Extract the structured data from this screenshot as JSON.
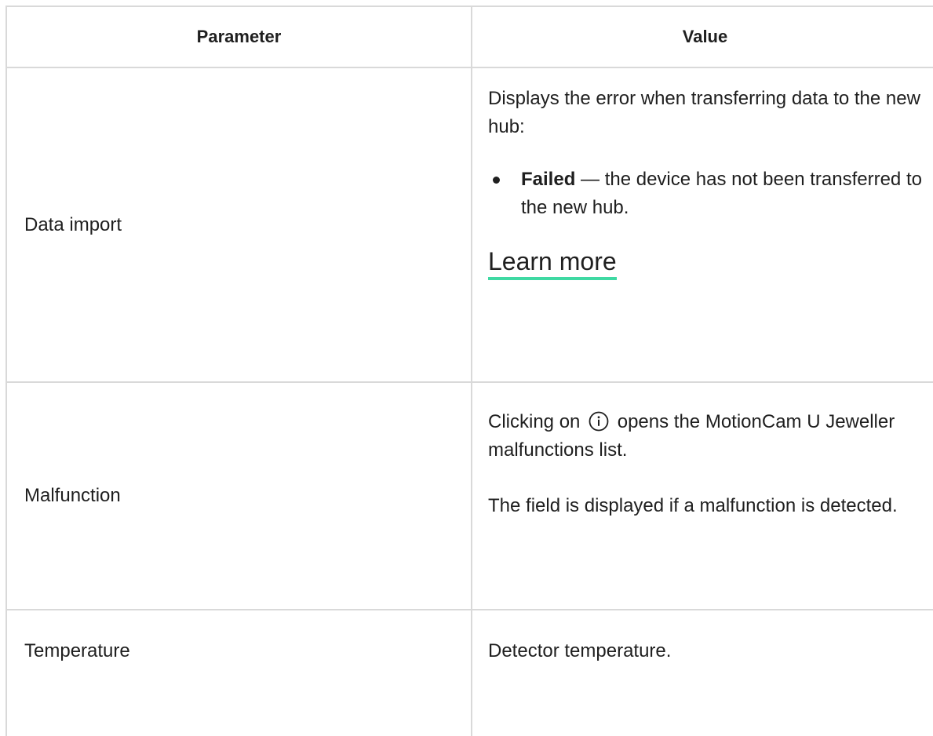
{
  "table": {
    "headers": {
      "parameter": "Parameter",
      "value": "Value"
    },
    "rows": [
      {
        "parameter": "Data import",
        "value_intro": "Displays the error when transferring data to the new hub:",
        "bullets": [
          {
            "term": "Failed",
            "text": " — the device has not been transferred to the new hub."
          }
        ],
        "link_label": "Learn more"
      },
      {
        "parameter": "Malfunction",
        "value_before_icon": "Clicking on",
        "value_after_icon": "opens the MotionCam U Jeweller malfunctions list.",
        "value_note": "The field is displayed if a malfunction is detected."
      },
      {
        "parameter": "Temperature",
        "value": "Detector temperature."
      }
    ]
  },
  "colors": {
    "border": "#d9d9d9",
    "text": "#1f1f1f",
    "link_underline": "#3fd9a3"
  },
  "icons": {
    "info": "info-circle-icon"
  }
}
